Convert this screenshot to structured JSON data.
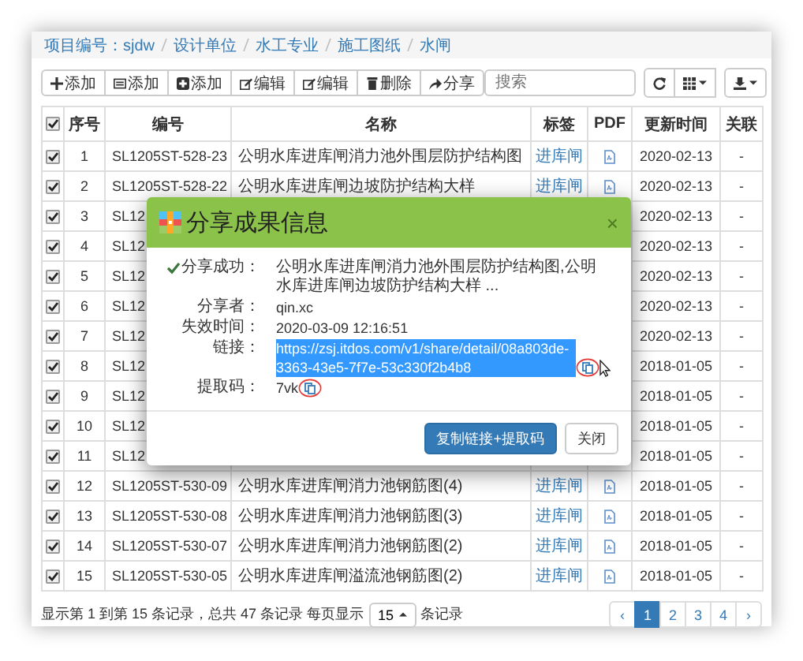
{
  "breadcrumb": [
    "项目编号：sjdw",
    "设计单位",
    "水工专业",
    "施工图纸",
    "水闸"
  ],
  "toolbar": {
    "buttons": [
      {
        "kind": "plus",
        "label": "添加"
      },
      {
        "kind": "list",
        "label": "添加"
      },
      {
        "kind": "plus-square",
        "label": "添加"
      },
      {
        "kind": "edit",
        "label": "编辑"
      },
      {
        "kind": "edit",
        "label": "编辑"
      },
      {
        "kind": "trash",
        "label": "删除"
      },
      {
        "kind": "share",
        "label": "分享"
      }
    ],
    "search": {
      "placeholder": "搜索"
    },
    "tools": [
      {
        "kind": "refresh"
      },
      {
        "kind": "grid"
      },
      {
        "kind": "export"
      }
    ]
  },
  "table": {
    "header_checked": true,
    "columns": [
      "序号",
      "编号",
      "名称",
      "标签",
      "PDF",
      "更新时间",
      "关联"
    ],
    "rows": [
      {
        "checked": true,
        "no": "1",
        "code": "SL1205ST-528-23",
        "name": "公明水库进库闸消力池外围层防护结构图",
        "tag": "进库闸",
        "pdf": true,
        "date": "2020-02-13",
        "link": "-"
      },
      {
        "checked": true,
        "no": "2",
        "code": "SL1205ST-528-22",
        "name": "公明水库进库闸边坡防护结构大样",
        "tag": "进库闸",
        "pdf": true,
        "date": "2020-02-13",
        "link": "-"
      },
      {
        "checked": true,
        "no": "3",
        "code": "SL12",
        "date": "2020-02-13",
        "link": "-"
      },
      {
        "checked": true,
        "no": "4",
        "code": "SL12",
        "date": "2020-02-13",
        "link": "-"
      },
      {
        "checked": true,
        "no": "5",
        "code": "SL12",
        "date": "2020-02-13",
        "link": "-"
      },
      {
        "checked": true,
        "no": "6",
        "code": "SL12",
        "date": "2020-02-13",
        "link": "-"
      },
      {
        "checked": true,
        "no": "7",
        "code": "SL12",
        "date": "2020-02-13",
        "link": "-"
      },
      {
        "checked": true,
        "no": "8",
        "code": "SL12",
        "date": "2018-01-05",
        "link": "-"
      },
      {
        "checked": true,
        "no": "9",
        "code": "SL12",
        "date": "2018-01-05",
        "link": "-"
      },
      {
        "checked": true,
        "no": "10",
        "code": "SL12",
        "date": "2018-01-05",
        "link": "-"
      },
      {
        "checked": true,
        "no": "11",
        "code": "SL12",
        "date": "2018-01-05",
        "link": "-"
      },
      {
        "checked": true,
        "no": "12",
        "code": "SL1205ST-530-09",
        "name": "公明水库进库闸消力池钢筋图(4)",
        "tag": "进库闸",
        "pdf": true,
        "date": "2018-01-05",
        "link": "-"
      },
      {
        "checked": true,
        "no": "13",
        "code": "SL1205ST-530-08",
        "name": "公明水库进库闸消力池钢筋图(3)",
        "tag": "进库闸",
        "pdf": true,
        "date": "2018-01-05",
        "link": "-"
      },
      {
        "checked": true,
        "no": "14",
        "code": "SL1205ST-530-07",
        "name": "公明水库进库闸消力池钢筋图(2)",
        "tag": "进库闸",
        "pdf": true,
        "date": "2018-01-05",
        "link": "-"
      },
      {
        "checked": true,
        "no": "15",
        "code": "SL1205ST-530-05",
        "name": "公明水库进库闸溢流池钢筋图(2)",
        "tag": "进库闸",
        "pdf": true,
        "date": "2018-01-05",
        "link": "-"
      }
    ]
  },
  "footer": {
    "summary": "显示第 1 到第 15 条记录，总共 47 条记录 每页显示",
    "page_size": "15",
    "suffix": "条记录",
    "pages": [
      {
        "label": "‹",
        "selected": false
      },
      {
        "label": "1",
        "selected": true
      },
      {
        "label": "2",
        "selected": false
      },
      {
        "label": "3",
        "selected": false
      },
      {
        "label": "4",
        "selected": false
      },
      {
        "label": "›",
        "selected": false
      }
    ]
  },
  "dialog": {
    "title": "分享成果信息",
    "close": "×",
    "fields": [
      {
        "kind": "success",
        "label": "分享成功：",
        "value": "公明水库进库闸消力池外围层防护结构图,公明水库进库闸边坡防护结构大样 ..."
      },
      {
        "kind": "text",
        "label": "分享者：",
        "value": "qin.xc"
      },
      {
        "kind": "text",
        "label": "失效时间：",
        "value": "2020-03-09 12:16:51"
      },
      {
        "kind": "link",
        "label": "链接：",
        "value": "https://zsj.itdos.com/v1/share/detail/08a803de-3363-43e5-7f7e-53c330f2b4b8",
        "highlighted": true,
        "copy": true
      },
      {
        "kind": "text",
        "label": "提取码：",
        "value": "7vk",
        "copy": true
      }
    ],
    "buttons": [
      {
        "label": "复制链接+提取码",
        "primary": true
      },
      {
        "label": "关闭",
        "primary": false
      }
    ]
  }
}
